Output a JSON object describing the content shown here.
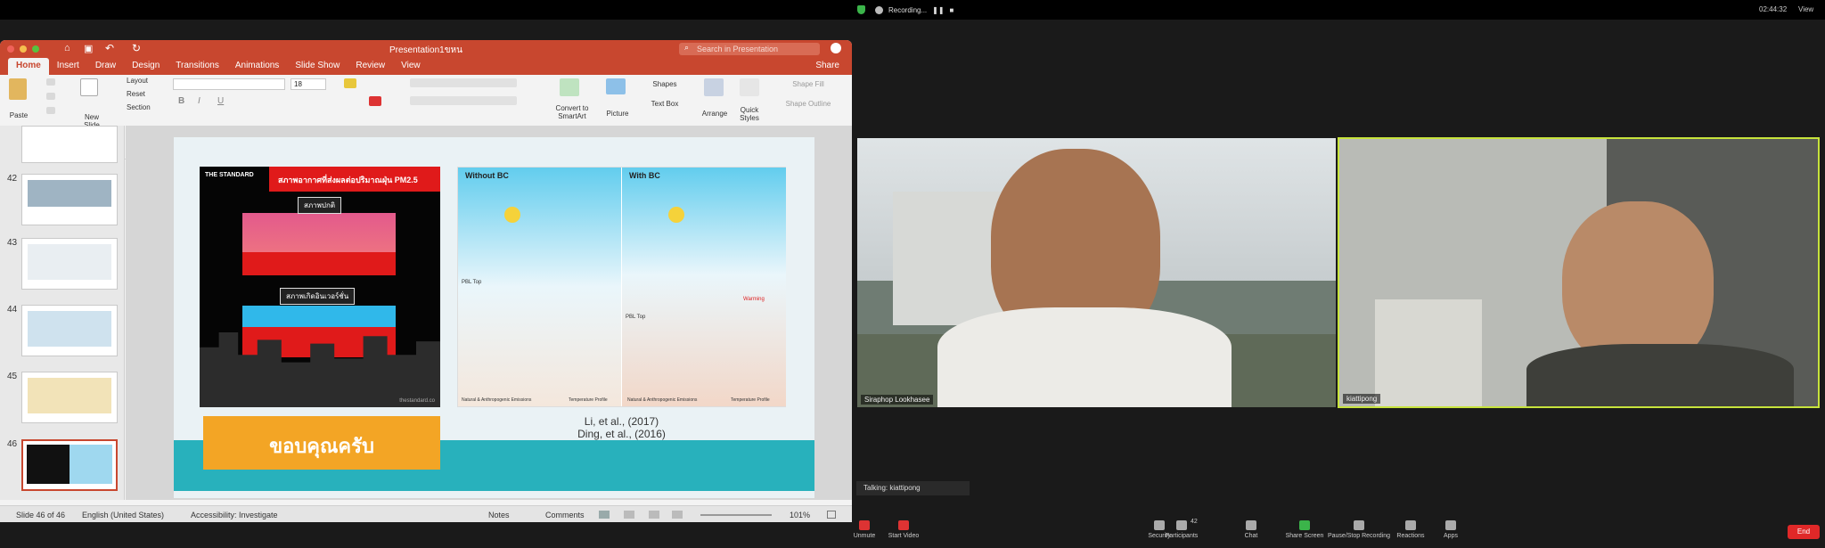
{
  "zoom": {
    "recording_label": "Recording...",
    "clock": "02:44:32",
    "view_label": "View",
    "talking": "Talking: kiattipong",
    "participant1_name": "Siraphop Lookhasee",
    "participant2_name": "kiattipong",
    "toolbar": {
      "unmute": "Unmute",
      "start_video": "Start Video",
      "security": "Security",
      "participants": "Participants",
      "participants_count": "42",
      "chat": "Chat",
      "share_screen": "Share Screen",
      "pause_recording": "Pause/Stop Recording",
      "reactions": "Reactions",
      "apps": "Apps",
      "end": "End"
    },
    "colors": {
      "speaker_highlight": "#c7e33c",
      "end": "#e02828",
      "share": "#3bb44a"
    }
  },
  "ppt": {
    "title": "Presentation1ขหน",
    "search_placeholder": "Search in Presentation",
    "tabs": [
      "Home",
      "Insert",
      "Draw",
      "Design",
      "Transitions",
      "Animations",
      "Slide Show",
      "Review",
      "View"
    ],
    "share": "Share",
    "ribbon": {
      "paste": "Paste",
      "new_slide": "New Slide",
      "layout": "Layout",
      "reset": "Reset",
      "section": "Section",
      "font_size": "18",
      "convert_smartart": "Convert to SmartArt",
      "picture": "Picture",
      "shapes": "Shapes",
      "text_box": "Text Box",
      "arrange": "Arrange",
      "quick_styles": "Quick Styles",
      "shape_fill": "Shape Fill",
      "shape_outline": "Shape Outline"
    },
    "slides": [
      "42",
      "43",
      "44",
      "45",
      "46"
    ],
    "slide": {
      "panel1_brand": "THE STANDARD",
      "panel1_header": "สภาพอากาศที่ส่งผลต่อปริมาณฝุ่น PM2.5",
      "panel1_normal": "สภาพปกติ",
      "panel1_inversion": "สภาพเกิดอินเวอร์ชั่น",
      "panel1_footer": "thestandard.co",
      "without_bc": "Without BC",
      "with_bc": "With BC",
      "pbl_top": "PBL Top",
      "warming": "Warming",
      "emissions_label": "Natural & Anthropogenic Emissions",
      "temp_profile": "Temperature Profile",
      "cite1": "Li, et al., (2017)",
      "cite2": "Ding, et al., (2016)",
      "thanks": "ขอบคุณครับ"
    },
    "status": {
      "slide_of": "Slide 46 of 46",
      "language": "English (United States)",
      "accessibility": "Accessibility: Investigate",
      "notes": "Notes",
      "comments": "Comments",
      "zoom": "101%"
    },
    "colors": {
      "accent": "#c8472f",
      "teal": "#28b1bc",
      "orange": "#f3a525"
    }
  }
}
